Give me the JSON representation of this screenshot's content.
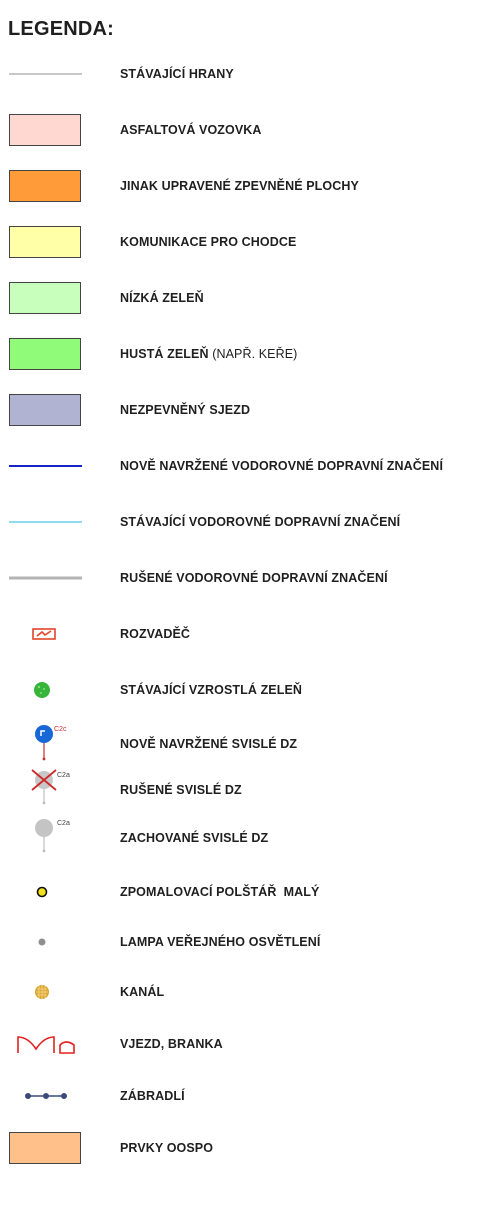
{
  "title": "LEGENDA:",
  "items": [
    {
      "label": "STÁVAJÍCÍ HRANY",
      "symbol": "existing-edge-line",
      "color": "#c8c8c8"
    },
    {
      "label": "ASFALTOVÁ VOZOVKA",
      "symbol": "asphalt-road-swatch",
      "color": "#ffd9d1"
    },
    {
      "label": "JINAK UPRAVENÉ ZPEVNĚNÉ PLOCHY",
      "symbol": "paved-area-swatch",
      "color": "#ff9b38"
    },
    {
      "label": "KOMUNIKACE PRO CHODCE",
      "symbol": "pedestrian-swatch",
      "color": "#ffffa8"
    },
    {
      "label": "NÍZKÁ ZELEŇ",
      "symbol": "low-greenery-swatch",
      "color": "#c8ffbc"
    },
    {
      "label": "HUSTÁ ZELEŇ",
      "label_suffix": "(NAPŘ. KEŘE)",
      "symbol": "dense-greenery-swatch",
      "color": "#90fb78"
    },
    {
      "label": "NEZPEVNĚNÝ SJEZD",
      "symbol": "unpaved-exit-swatch",
      "color": "#b0b4d2"
    },
    {
      "label": "NOVĚ NAVRŽENÉ VODOROVNÉ DOPRAVNÍ ZNAČENÍ",
      "symbol": "new-horizontal-marking-line",
      "color": "#1a23c8"
    },
    {
      "label": "STÁVAJÍCÍ VODOROVNÉ DOPRAVNÍ ZNAČENÍ",
      "symbol": "existing-horizontal-marking-line",
      "color": "#8fdcf2"
    },
    {
      "label": "RUŠENÉ VODOROVNÉ DOPRAVNÍ ZNAČENÍ",
      "symbol": "removed-horizontal-marking-line",
      "color": "#b4b4b4"
    },
    {
      "label": "ROZVADĚČ",
      "symbol": "switchboard-icon",
      "color": "#e3452a"
    },
    {
      "label": "STÁVAJÍCÍ VZROSTLÁ ZELEŇ",
      "symbol": "tree-icon",
      "color": "#36b53a"
    },
    {
      "label": "NOVĚ NAVRŽENÉ SVISLÉ DZ",
      "symbol": "new-vertical-sign-icon",
      "color": "#1767d6",
      "sign_code": "C2c"
    },
    {
      "label": "RUŠENÉ SVISLÉ DZ",
      "symbol": "removed-vertical-sign-icon",
      "color": "#cc2a2a",
      "sign_code": "C2a"
    },
    {
      "label": "ZACHOVANÉ SVISLÉ DZ",
      "symbol": "kept-vertical-sign-icon",
      "color": "#bcbcbc",
      "sign_code": "C2a"
    },
    {
      "label": "ZPOMALOVACÍ POLŠTÁŘ  MALÝ",
      "symbol": "speed-cushion-icon",
      "color": "#f1e21a"
    },
    {
      "label": "LAMPA VEŘEJNÉHO OSVĚTLENÍ",
      "symbol": "street-lamp-icon",
      "color": "#8f8f8f"
    },
    {
      "label": "KANÁL",
      "symbol": "manhole-icon",
      "color": "#d9a532"
    },
    {
      "label": "VJEZD, BRANKA",
      "symbol": "gate-icon",
      "color": "#e32020"
    },
    {
      "label": "ZÁBRADLÍ",
      "symbol": "railing-icon",
      "color": "#3a4a7a"
    },
    {
      "label": "PRVKY OOSPO",
      "symbol": "oospo-swatch",
      "color": "#ffc08a"
    }
  ]
}
